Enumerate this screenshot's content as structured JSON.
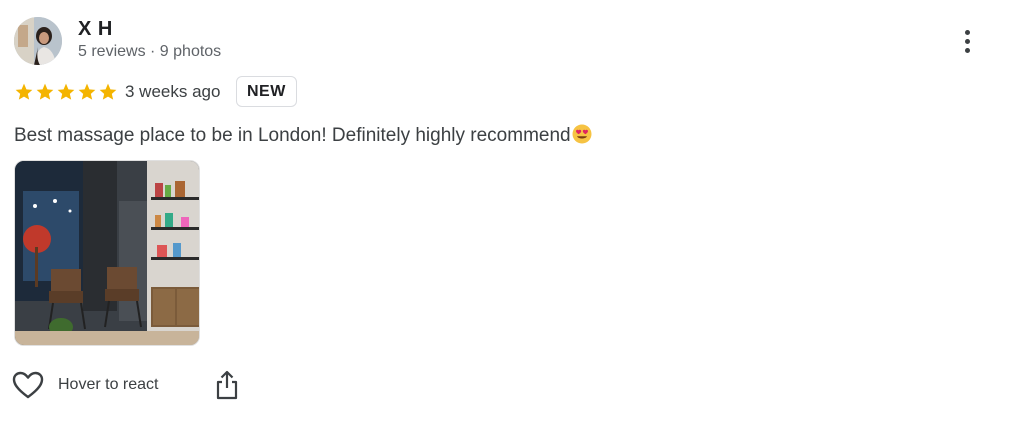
{
  "reviewer": {
    "name": "X H",
    "meta": "5 reviews · 9 photos"
  },
  "rating": {
    "value": 5,
    "max": 5,
    "color": "#f4b400"
  },
  "time": "3 weeks ago",
  "badge": "NEW",
  "review_text": "Best massage place to be in London! Definitely highly recommend",
  "review_emoji": "heart-eyes-emoji",
  "photos_count_shown": 1,
  "actions": {
    "react_label": "Hover to react",
    "react_icon": "heart-outline-icon",
    "share_icon": "share-icon",
    "more_icon": "more-vertical-icon"
  }
}
